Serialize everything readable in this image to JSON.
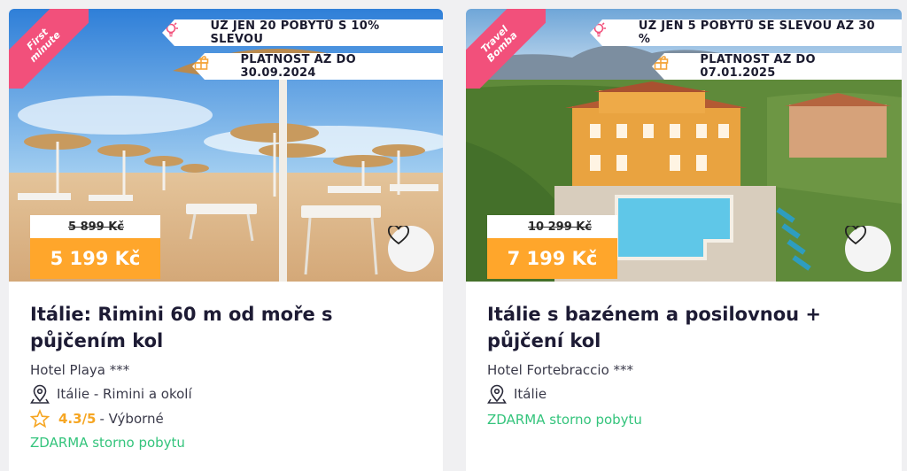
{
  "cards": [
    {
      "corner_label": "First\nminute",
      "tag_offer": "UŽ JEN 20 POBYTŮ S 10% SLEVOU",
      "tag_validity": "PLATNOST AŽ DO 30.09.2024",
      "old_price": "5 899 Kč",
      "new_price": "5 199 Kč",
      "title": "Itálie: Rimini 60 m od moře s půjčením kol",
      "hotel": "Hotel Playa ***",
      "location": "Itálie - Rimini a okolí",
      "rating_score": "4.3/5",
      "rating_text": "- Výborné",
      "free_cancel": "ZDARMA storno pobytu",
      "icons": {
        "offer": "lightbulb-icon",
        "validity": "gift-icon",
        "favorite": "heart-icon",
        "location": "map-pin-icon",
        "rating": "star-icon"
      }
    },
    {
      "corner_label": "Travel\nBomba",
      "tag_offer": "UŽ JEN 5 POBYTŮ SE SLEVOU AŽ 30 %",
      "tag_validity": "PLATNOST AŽ DO 07.01.2025",
      "old_price": "10 299 Kč",
      "new_price": "7 199 Kč",
      "title": "Itálie s bazénem a posilovnou + půjčení kol",
      "hotel": "Hotel Fortebraccio ***",
      "location": "Itálie",
      "free_cancel": "ZDARMA storno pobytu",
      "icons": {
        "offer": "lightbulb-icon",
        "validity": "gift-icon",
        "favorite": "heart-icon",
        "location": "map-pin-icon"
      }
    }
  ],
  "colors": {
    "corner": "#f2507b",
    "price_badge": "#ffa62b",
    "accent_green": "#34c47c",
    "rating_star": "#f6a623",
    "title": "#1d1b34"
  }
}
